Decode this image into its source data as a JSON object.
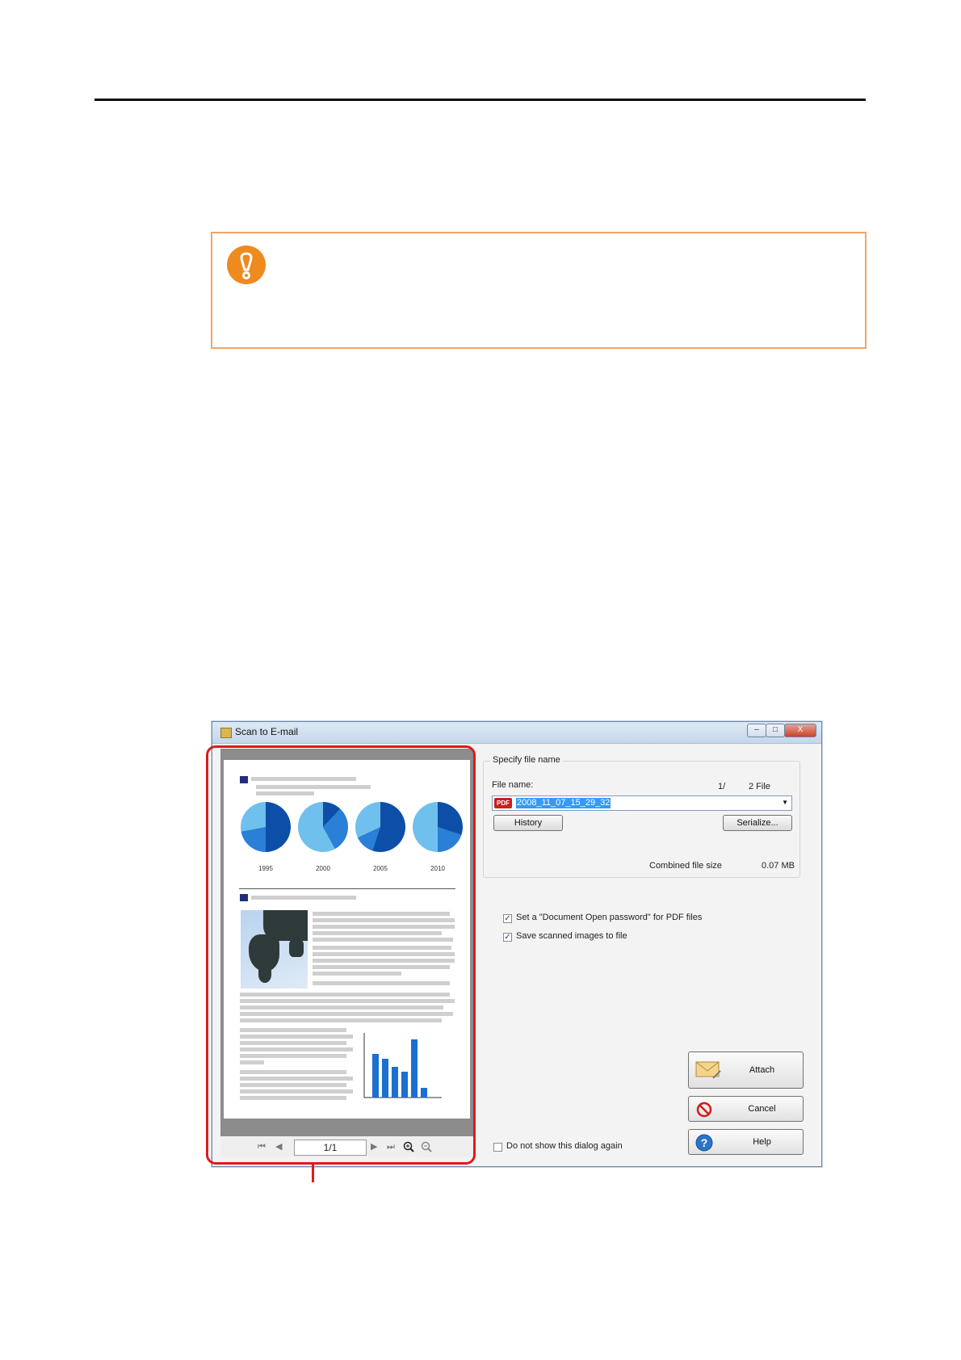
{
  "dialog": {
    "title": "Scan to E-mail",
    "window_buttons": {
      "minimize": "–",
      "maximize": "□",
      "close": "X"
    }
  },
  "preview": {
    "chart_years": [
      "1995",
      "2000",
      "2005",
      "2010"
    ],
    "page_indicator": "1/1"
  },
  "file_name_group": {
    "label": "Specify file name",
    "file_name_label": "File name:",
    "file_counter": "1/",
    "file_counter_total": "2  File",
    "file_type_badge": "PDF",
    "file_name_value": "2008_11_07_15_29_32",
    "history_button": "History",
    "serialize_button": "Serialize...",
    "combined_size_label": "Combined file size",
    "combined_size_value": "0.07 MB"
  },
  "options": {
    "document_open_password": {
      "label": "Set a \"Document Open password\" for PDF files",
      "checked": true
    },
    "save_scanned_images": {
      "label": "Save scanned images to file",
      "checked": true
    },
    "do_not_show_again": {
      "label": "Do not show this dialog again",
      "checked": false
    }
  },
  "actions": {
    "attach": "Attach",
    "cancel": "Cancel",
    "help": "Help"
  },
  "colors": {
    "callout_outline": "#e0191e",
    "caution_border": "#f4a460",
    "caution_icon": "#ef8a1f"
  }
}
